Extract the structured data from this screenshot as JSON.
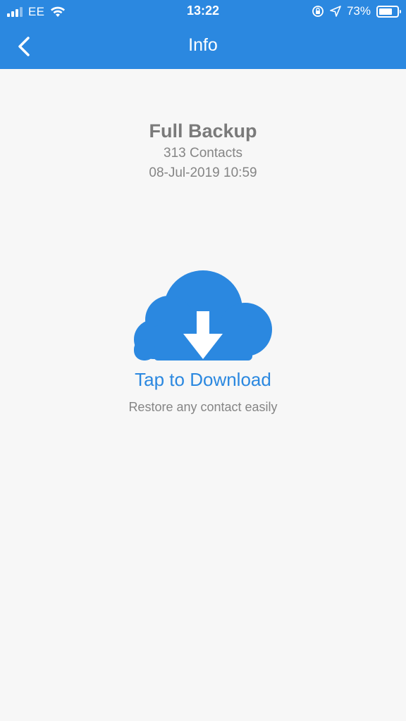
{
  "status_bar": {
    "carrier": "EE",
    "time": "13:22",
    "battery": "73%",
    "battery_level": 0.73,
    "icons": [
      "signal-icon",
      "wifi-icon",
      "orientation-lock-icon",
      "location-icon",
      "battery-icon"
    ]
  },
  "nav": {
    "title": "Info",
    "back_icon": "chevron-left-icon"
  },
  "backup": {
    "title": "Full Backup",
    "count": "313 Contacts",
    "date": "08-Jul-2019 10:59"
  },
  "download": {
    "icon": "cloud-download-icon",
    "label": "Tap to Download",
    "subtitle": "Restore any contact easily"
  },
  "colors": {
    "accent": "#2b88e0",
    "background": "#f7f7f7",
    "text_secondary": "#858585"
  }
}
